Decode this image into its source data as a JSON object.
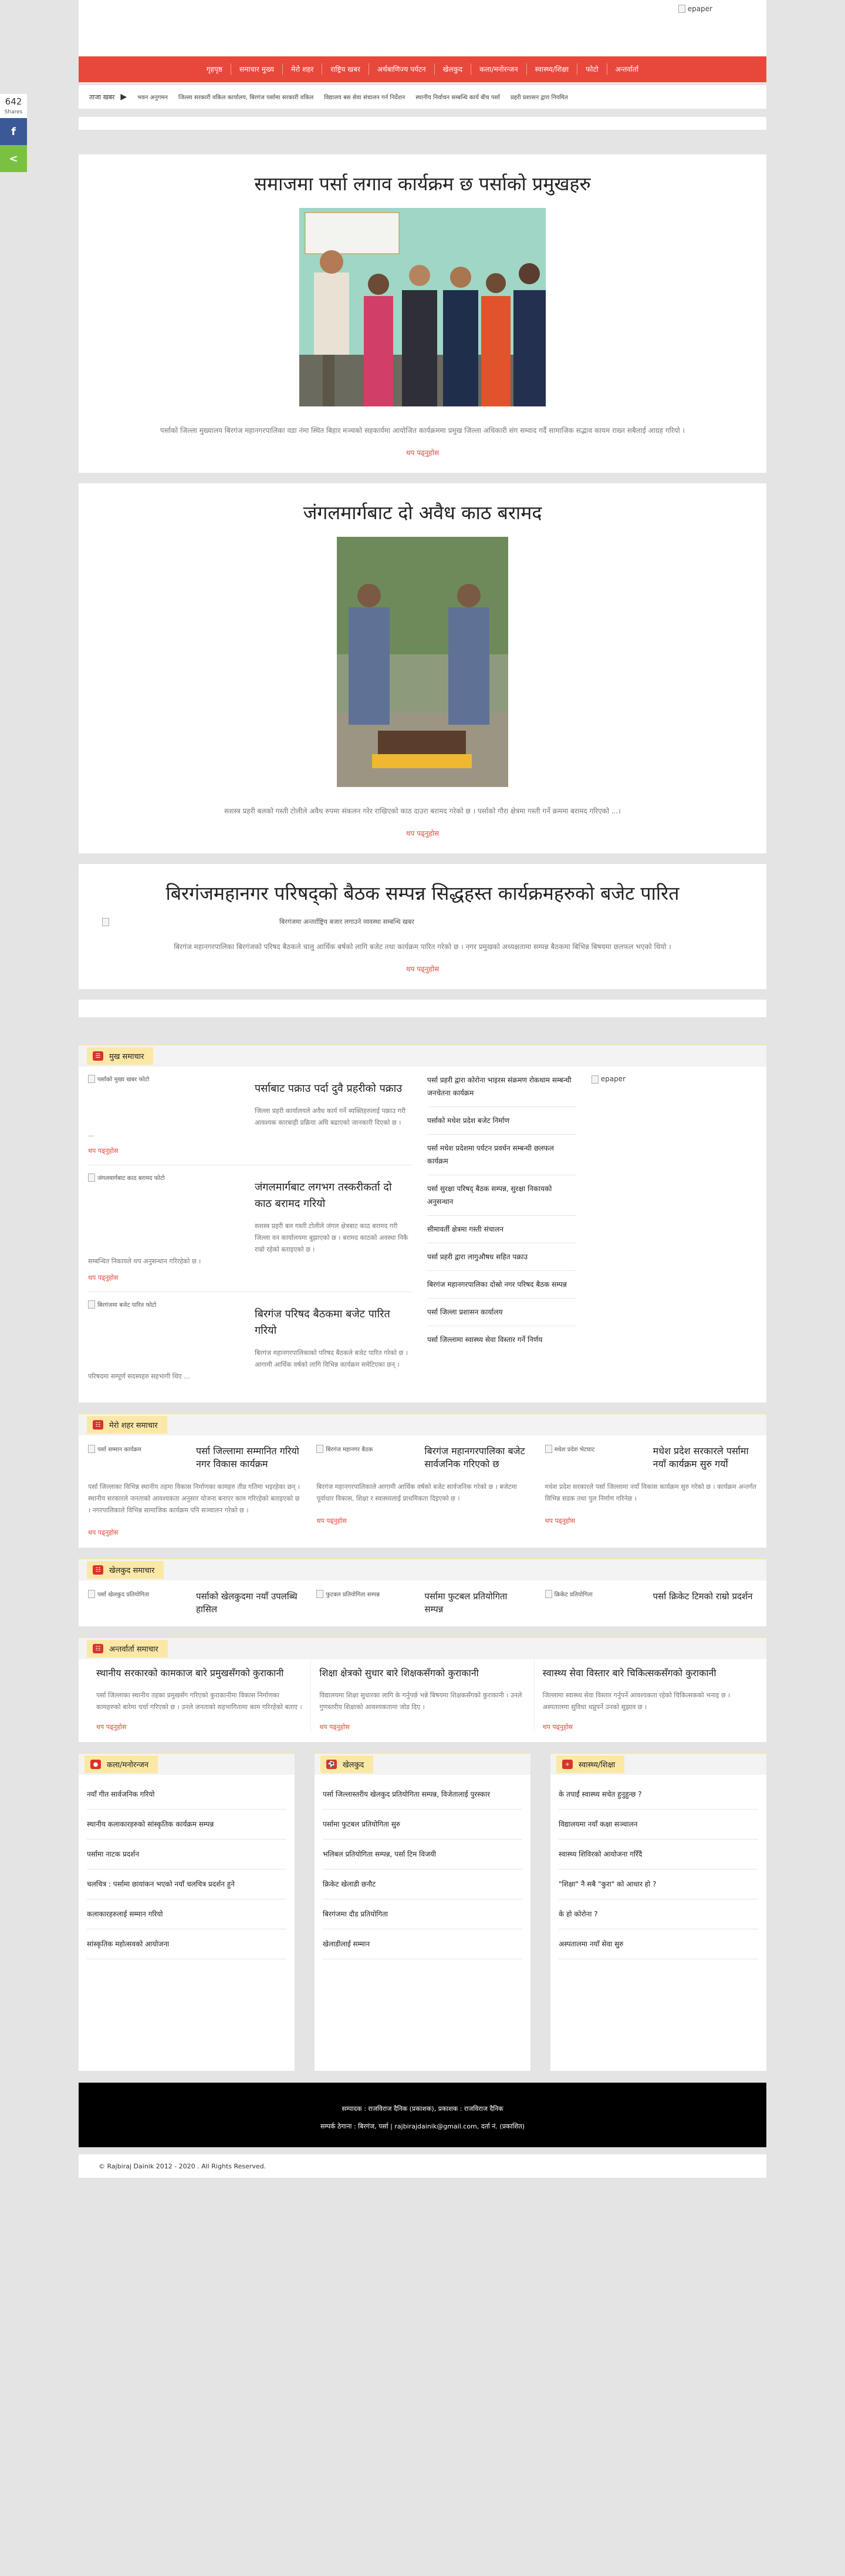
{
  "share": {
    "count": "642",
    "label": "Shares",
    "fb": "f",
    "more": "<"
  },
  "header": {
    "epaper": "epaper"
  },
  "nav": [
    "गृहपृष्ठ",
    "समाचार मुख्य",
    "मेरो शहर",
    "राष्ट्रिय खबर",
    "अर्थबाणिज्य पर्यटन",
    "खेलकुद",
    "कला/मनोरन्जन",
    "स्वास्थ्य/शिक्षा",
    "फोटो",
    "अन्तर्वार्ता"
  ],
  "ticker": {
    "label": "ताजा खबर",
    "items": [
      "भवन अनुगमन",
      "जिल्ला सरकारी वकिल कार्यालय, बिरगंज पर्सामा सरकारी वकिल",
      "विद्यालय बस सेवा संचालन गर्न निर्देशन",
      "स्थानीय निर्वाचन सम्बन्धि कार्य बीच पर्सा",
      "प्रहरी प्रशासन द्वारा नियमित"
    ]
  },
  "stories": [
    {
      "title": "समाजमा पर्सा लगाव कार्यक्रम छ पर्साको प्रमुखहरु",
      "excerpt": "पर्साको जिल्ला मुख्यालय बिरगंज महानगरपालिका वडा नंमा स्थित बिहार मञ्चको सहकार्यमा आयोजित कार्यक्रममा प्रमुख जिल्ला अधिकारी संग सम्वाद गर्दै सामाजिक सद्भाव कायम राख्न सबैलाई आग्रह गरियो ।",
      "more": "थप पढ्नुहोस"
    },
    {
      "title": "जंगलमार्गबाट दो अवैध काठ बरामद",
      "excerpt": "सशस्त्र प्रहरी बलको गस्ती टोलीले अवैध रुपमा संकलन गरेर राखिएको काठ दाउरा बरामद गरेको छ । पर्साको गौरा क्षेत्रमा गस्ती गर्ने क्रममा बरामद गरिएको ...।",
      "more": "थप पढ्नुहोस"
    },
    {
      "title": "बिरगंजमहानगर परिषद्को बैठक सम्पन्न सिद्धहस्त कार्यक्रमहरुको बजेट पारित",
      "image_caption": "बिरगंजमा अन्तर्राष्ट्रिय बजार लगाउने व्यवस्था सम्बन्धि खबर",
      "excerpt": "बिरगंज महानगरपालिका बिरगंजको परिषद बैठकले चालु आर्थिक बर्षको लागि बजेट तथा कार्यक्रम पारित गरेको छ । नगर प्रमुखको अध्यक्षतामा सम्पन्न बैठकमा बिभिन्न बिषयमा छलफल भएको थियो ।",
      "more": "थप पढ्नुहोस"
    }
  ],
  "news_section": {
    "title": "मुख समाचार",
    "items": [
      {
        "thumb": "पर्साको मुख्य खबर फोटो",
        "title": "पर्साबाट पक्राउ पर्दा दुवै प्रहरीको पक्राउ",
        "excerpt": "जिल्ला प्रहरी कार्यालयले अवैध कार्य गर्ने ब्यक्तिहरुलाई पक्राउ गरी आवश्यक कारबाही प्रक्रिया अघि बढाएको जानकारी दिएको छ ।",
        "cont": "...",
        "more": "थप पढ्नुहोस"
      },
      {
        "thumb": "जंगलमार्गबाट काठ बरामद फोटो",
        "title": "जंगलमार्गबाट लगभग तस्करीकर्ता दो काठ बरामद गरियो",
        "excerpt": "सशस्त्र प्रहरी बल गस्ती टोलीले जंगल क्षेत्रबाट काठ बरामद गरी जिल्ला वन कार्यालयमा बुझाएको छ । बरामद काठको अवस्था निकै राम्रो रहेको बताइएको छ ।",
        "cont": "सम्बन्धित निकायले थप अनुसन्धान गरिरहेको छ ।",
        "more": "थप पढ्नुहोस"
      },
      {
        "thumb": "बिरगंजमा बजेट पारित फोटो",
        "title": "बिरगंज परिषद बैठकमा बजेट पारित गरियो",
        "excerpt": "बिरगंज महानगरपालिकाको परिषद बैठकले बजेट पारित गरेको छ । आगामी आर्थिक वर्षको लागि विभिन्न कार्यक्रम समेटिएका छन् ।",
        "cont": "परिषदमा सम्पूर्ण सदस्यहरु सहभागी थिए ...",
        "more": "थप पढ्नुहोस"
      }
    ],
    "side_list": [
      "पर्सा प्रहरी द्वारा कोरोना भाइरस संक्रमण रोकथाम सम्बन्धी जनचेतना कार्यक्रम",
      "पर्साको मधेश प्रदेश बजेट निर्माण",
      "पर्सा मधेश प्रदेशमा पर्यटन प्रवर्धन सम्बन्धी छलफल कार्यक्रम",
      "पर्सा सुरक्षा परिषद् बैठक सम्पन्न, सुरक्षा निकायको अनुसन्धान",
      "सीमावर्ती क्षेत्रमा गस्ती संचालन",
      "पर्सा प्रहरी द्वारा लागुऔषध सहित पक्राउ",
      "बिरगंज महानगरपालिका दोस्रो नगर परिषद बैठक सम्पन्न",
      "पर्सा जिल्ला प्रशासन कार्यालय",
      "पर्सा जिल्लामा स्वास्थ्य सेवा विस्तार गर्ने निर्णय"
    ],
    "ad": "epaper"
  },
  "province": {
    "title": "मेरो शहर समाचार",
    "cols": [
      {
        "thumb": "पर्सा सम्मान कार्यक्रम",
        "title": "पर्सा जिल्लामा सम्मानित गरियो नगर विकास कार्यक्रम",
        "excerpt": "पर्सा जिल्लाका विभिन्न स्थानीय तहमा विकास निर्माणका कामहरु तीव्र गतिमा भइरहेका छन् । स्थानीय सरकारले जनताको आवश्यकता अनुसार योजना बनाएर काम गरिरहेको बताइएको छ । नगरपालिकाले विभिन्न सामाजिक कार्यक्रम पनि सञ्चालन गरेको छ ।",
        "more": "थप पढ्नुहोस"
      },
      {
        "thumb": "बिरगंज महानगर बैठक",
        "title": "बिरगंज महानगरपालिका बजेट सार्वजनिक गरिएको छ",
        "excerpt": "बिरगंज महानगरपालिकाले आगामी आर्थिक वर्षको बजेट सार्वजनिक गरेको छ । बजेटमा पूर्वाधार विकास, शिक्षा र स्वास्थ्यलाई प्राथमिकता दिइएको छ ।",
        "more": "थप पढ्नुहोस"
      },
      {
        "thumb": "मधेश प्रदेश भेटघाट",
        "title": "मधेश प्रदेश सरकारले पर्सामा नयाँ कार्यक्रम सुरु गर्यो",
        "excerpt": "मधेश प्रदेश सरकारले पर्सा जिल्लामा नयाँ विकास कार्यक्रम सुरु गरेको छ । कार्यक्रम अन्तर्गत विभिन्न सडक तथा पुल निर्माण गरिनेछ ।",
        "more": "थप पढ्नुहोस"
      }
    ]
  },
  "sports": {
    "title": "खेलकुद समाचार",
    "cols": [
      {
        "thumb": "पर्सा खेलकुद प्रतियोगिता",
        "title": "पर्साको खेलकुदमा नयाँ उपलब्धि हासिल"
      },
      {
        "thumb": "फुटबल प्रतियोगिता सम्पन्न",
        "title": "पर्सामा फुटबल प्रतियोगिता सम्पन्न"
      },
      {
        "thumb": "क्रिकेट प्रतियोगिता",
        "title": "पर्सा क्रिकेट टिमको राम्रो प्रदर्शन"
      }
    ]
  },
  "interview": {
    "title": "अन्तर्वार्ता समाचार",
    "cols": [
      {
        "title": "स्थानीय सरकारको कामकाज बारे प्रमुखसँगको कुराकानी",
        "excerpt": "पर्सा जिल्लाका स्थानीय तहका प्रमुखसँग गरिएको कुराकानीमा विकास निर्माणका कामहरुको बारेमा चर्चा गरिएको छ । उनले जनताको सहभागितामा काम गरिरहेको बताए ।",
        "more": "थप पढ्नुहोस"
      },
      {
        "title": "शिक्षा क्षेत्रको सुधार बारे शिक्षकसँगको कुराकानी",
        "excerpt": "विद्यालयमा शिक्षा सुधारका लागि के गर्नुपर्छ भन्ने बिषयमा शिक्षकसँगको कुराकानी । उनले गुणस्तरीय शिक्षाको आवश्यकतामा जोड दिए ।",
        "more": "थप पढ्नुहोस"
      },
      {
        "title": "स्वास्थ्य सेवा विस्तार बारे चिकित्सकसँगको कुराकानी",
        "excerpt": "जिल्लामा स्वास्थ्य सेवा विस्तार गर्नुपर्ने आवश्यकता रहेको चिकित्सकको भनाइ छ । अस्पतालमा सुविधा थप्नुपर्ने उनको सुझाव छ ।",
        "more": "थप पढ्नुहोस"
      }
    ]
  },
  "bottom": [
    {
      "title": "कला/मनोरन्जन",
      "items": [
        "नयाँ गीत सार्वजनिक गरियो",
        "स्थानीय कलाकारहरुको सांस्कृतिक कार्यक्रम सम्पन्न",
        "पर्सामा नाटक प्रदर्शन",
        "चलचित्र : पर्सामा छायांकन भएको नयाँ चलचित्र प्रदर्शन हुने",
        "कलाकारहरुलाई सम्मान गरियो",
        "सांस्कृतिक महोत्सवको आयोजना"
      ]
    },
    {
      "title": "खेलकुद",
      "items": [
        "पर्सा जिल्लास्तरीय खेलकुद प्रतियोगिता सम्पन्न, विजेतालाई पुरस्कार",
        "पर्सामा फुटबल प्रतियोगिता सुरु",
        "भलिबल प्रतियोगिता सम्पन्न, पर्सा टिम विजयी",
        "क्रिकेट खेलाडी छनौट",
        "बिरगंजमा दौड प्रतियोगिता",
        "खेलाडीलाई सम्मान"
      ]
    },
    {
      "title": "स्वास्थ्य/शिक्षा",
      "items": [
        "के तपाईं स्वास्थ्य सचेत हुनुहुन्छ ?",
        "विद्यालयमा नयाँ कक्षा सञ्चालन",
        "स्वास्थ्य शिविरको आयोजना गरिँदै",
        "\"शिक्षा\" नै सबै \"कुरा\" को आधार हो ?",
        "के हो कोरोना ?",
        "अस्पतालमा नयाँ सेवा सुरु"
      ]
    }
  ],
  "footer": {
    "line1": "सम्पादक : राजविराज दैनिक (प्रकाशक), प्रकाशक : राजविराज दैनिक",
    "line2": "सम्पर्क ठेगाना : बिरगंज, पर्सा | rajbirajdainik@gmail.com, दर्ता नं. (प्रकाशित)",
    "copyright": "© Rajbiraj Dainik 2012 - 2020 . All Rights Reserved."
  }
}
